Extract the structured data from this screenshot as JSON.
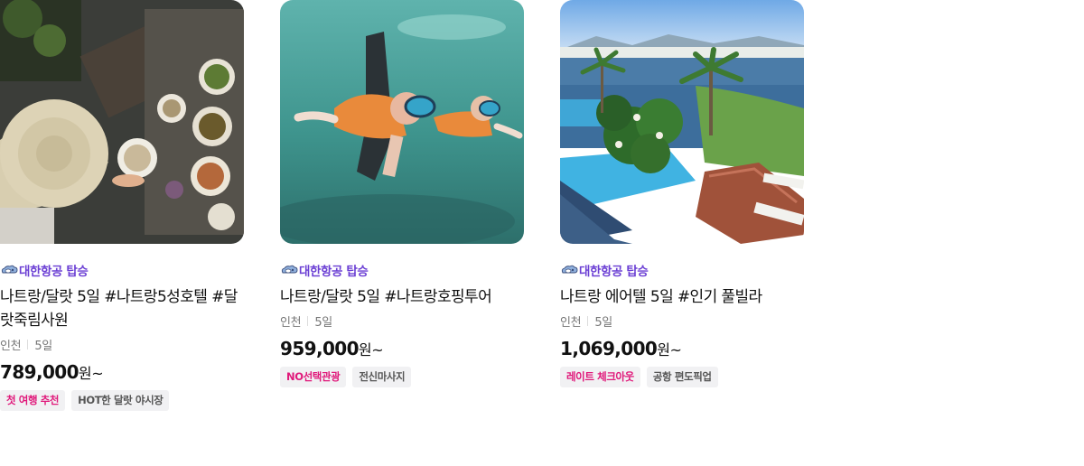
{
  "products": [
    {
      "airline": "대한항공 탑승",
      "title": "나트랑/달랏 5일 #나트랑5성호텔 #달랏죽림사원",
      "departure": "인천",
      "duration": "5일",
      "price": "789,000",
      "price_unit": "원~",
      "tags": [
        {
          "label": "첫 여행 추천",
          "style": "pink"
        },
        {
          "label": "HOT한 달랏 야시장",
          "style": "gray"
        }
      ]
    },
    {
      "airline": "대한항공 탑승",
      "title": "나트랑/달랏 5일 #나트랑호핑투어",
      "departure": "인천",
      "duration": "5일",
      "price": "959,000",
      "price_unit": "원~",
      "tags": [
        {
          "label": "NO선택관광",
          "style": "pink"
        },
        {
          "label": "전신마사지",
          "style": "gray"
        }
      ]
    },
    {
      "airline": "대한항공 탑승",
      "title": "나트랑 에어텔 5일 #인기 풀빌라",
      "departure": "인천",
      "duration": "5일",
      "price": "1,069,000",
      "price_unit": "원~",
      "tags": [
        {
          "label": "레이트 체크아웃",
          "style": "pink"
        },
        {
          "label": "공항 편도픽업",
          "style": "gray"
        }
      ]
    }
  ],
  "colors": {
    "airline_text": "#6b3fd4",
    "tag_pink": "#e0187a",
    "tag_gray": "#555555",
    "tag_bg": "#f1f1f3"
  }
}
